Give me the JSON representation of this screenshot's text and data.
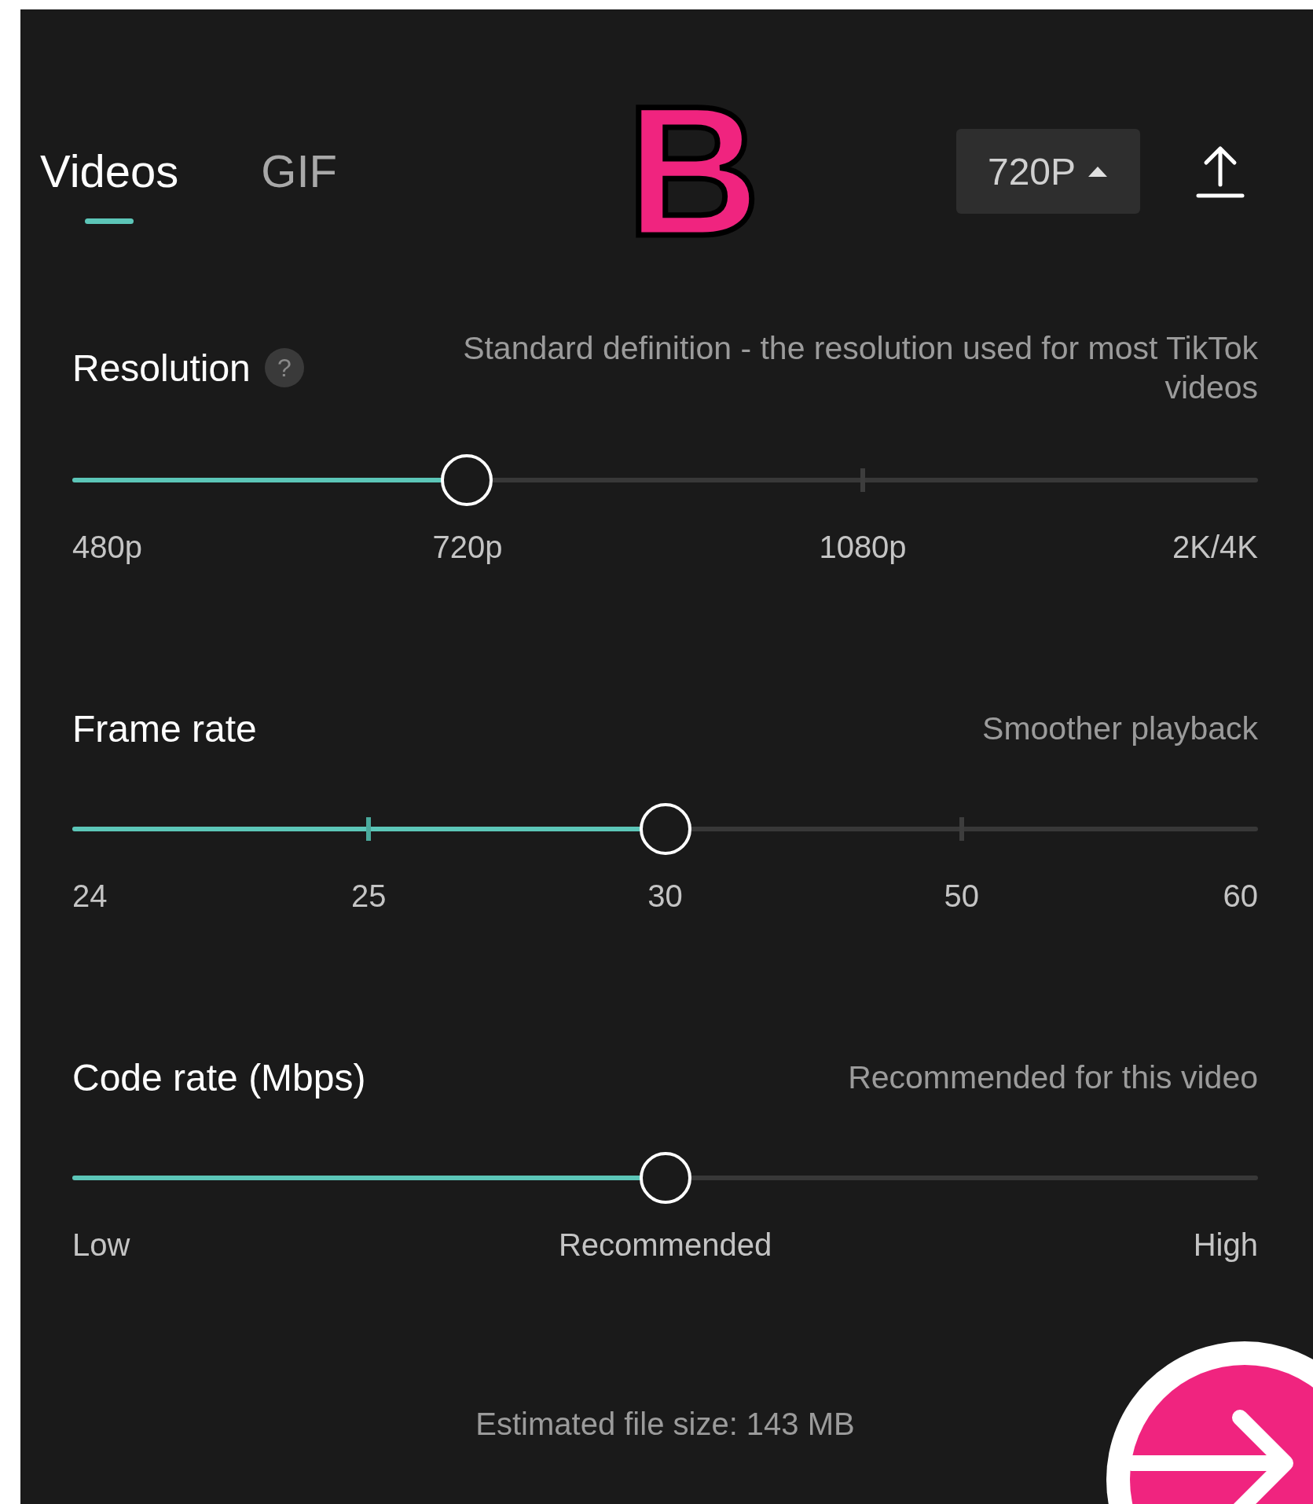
{
  "tabs": [
    {
      "label": "Videos",
      "selected": true
    },
    {
      "label": "GIF",
      "selected": false
    }
  ],
  "overlay_label": "B",
  "resolution_button": {
    "label": "720P",
    "expanded": false
  },
  "settings": [
    {
      "title": "Resolution",
      "help": "?",
      "description": "Standard definition - the resolution used for most TikTok videos",
      "level": 0.333,
      "stops": [
        "480p",
        "720p",
        "1080p",
        "2K/4K"
      ]
    },
    {
      "title": "Frame rate",
      "description": "Smoother playback",
      "level": 0.5,
      "stops": [
        "24",
        "25",
        "30",
        "50",
        "60"
      ]
    },
    {
      "title": "Code rate (Mbps)",
      "description": "Recommended for this video",
      "level": 0.5,
      "stops": [
        "Low",
        "Recommended",
        "High"
      ]
    }
  ],
  "estimate": "Estimated file size: 143 MB"
}
